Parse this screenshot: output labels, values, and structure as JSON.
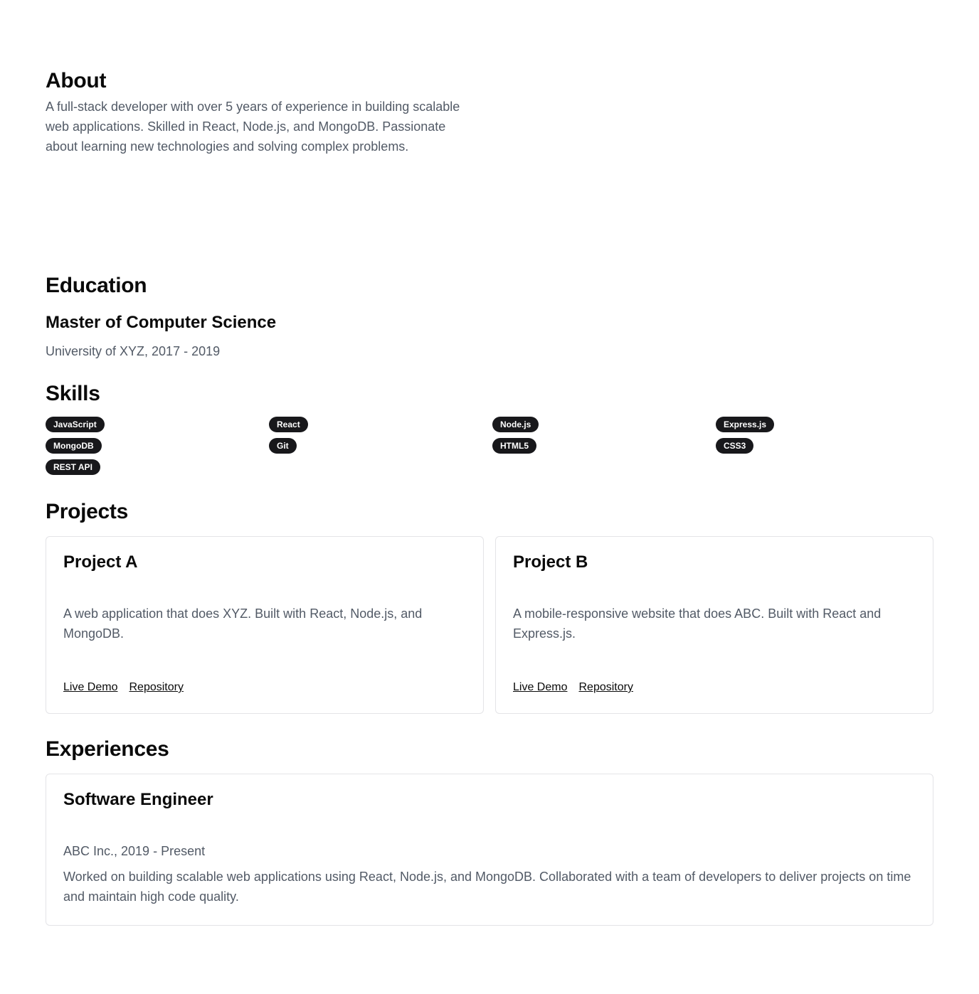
{
  "about": {
    "heading": "About",
    "text": "A full-stack developer with over 5 years of experience in building scalable web applications. Skilled in React, Node.js, and MongoDB. Passionate about learning new technologies and solving complex problems."
  },
  "education": {
    "heading": "Education",
    "degree": "Master of Computer Science",
    "school": "University of XYZ, 2017 - 2019"
  },
  "skills": {
    "heading": "Skills",
    "items": [
      "JavaScript",
      "React",
      "Node.js",
      "Express.js",
      "MongoDB",
      "Git",
      "HTML5",
      "CSS3",
      "REST API"
    ]
  },
  "projects": {
    "heading": "Projects",
    "items": [
      {
        "title": "Project A",
        "description": "A web application that does XYZ. Built with React, Node.js, and MongoDB.",
        "demo_label": "Live Demo",
        "repo_label": "Repository"
      },
      {
        "title": "Project B",
        "description": "A mobile-responsive website that does ABC. Built with React and Express.js.",
        "demo_label": "Live Demo",
        "repo_label": "Repository"
      }
    ]
  },
  "experiences": {
    "heading": "Experiences",
    "items": [
      {
        "title": "Software Engineer",
        "company": "ABC Inc., 2019 - Present",
        "description": "Worked on building scalable web applications using React, Node.js, and MongoDB. Collaborated with a team of developers to deliver projects on time and maintain high code quality."
      }
    ]
  },
  "colors": {
    "text": "#0a0a0a",
    "muted": "#525a66",
    "badge_bg": "#18181b",
    "border": "#e4e4e7"
  }
}
